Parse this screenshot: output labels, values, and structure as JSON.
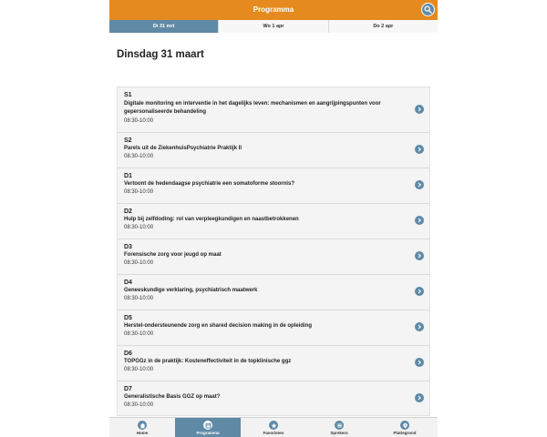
{
  "header": {
    "title": "Programma"
  },
  "tabs": [
    {
      "label": "Di 31 mrt",
      "active": true
    },
    {
      "label": "Wo 1 apr",
      "active": false
    },
    {
      "label": "Do 2 apr",
      "active": false
    }
  ],
  "day_title": "Dinsdag 31 maart",
  "sessions": [
    {
      "code": "S1",
      "title": "Digitale monitoring en interventie in het dagelijks leven: mechanismen en aangrijpingspunten voor gepersonaliseerde behandeling",
      "time": "08:30-10:00"
    },
    {
      "code": "S2",
      "title": "Parels uit de ZiekenhuisPsychiatrie Praktijk II",
      "time": "08:30-10:00"
    },
    {
      "code": "D1",
      "title": "Vertoont de hedendaagse psychiatrie een somatoforme stoornis?",
      "time": "08:30-10:00"
    },
    {
      "code": "D2",
      "title": "Hulp bij zelfdoding: rol van verpleegkundigen en naastbetrokkenen",
      "time": "08:30-10:00"
    },
    {
      "code": "D3",
      "title": "Forensische zorg voor jeugd op maat",
      "time": "08:30-10:00"
    },
    {
      "code": "D4",
      "title": "Geneeskundige verklaring, psychiatrisch maatwerk",
      "time": "08:30-10:00"
    },
    {
      "code": "D5",
      "title": "Herstel-ondersteunende zorg en shared decision making in de opleiding",
      "time": "08:30-10:00"
    },
    {
      "code": "D6",
      "title": "TOPGGz in de praktijk: Kosteneffectiviteit in de topklinische ggz",
      "time": "08:30-10:00"
    },
    {
      "code": "D7",
      "title": "Generalistische Basis GGZ op maat?",
      "time": "08:30-10:00"
    }
  ],
  "bottom_nav": [
    {
      "label": "Home",
      "icon": "home-icon",
      "active": false
    },
    {
      "label": "Programma",
      "icon": "calendar-icon",
      "active": true
    },
    {
      "label": "Favorieten",
      "icon": "star-icon",
      "active": false
    },
    {
      "label": "Sprekers",
      "icon": "list-icon",
      "active": false
    },
    {
      "label": "Plattegrond",
      "icon": "map-pin-icon",
      "active": false
    }
  ],
  "colors": {
    "accent": "#e58a1f",
    "primary": "#5f8aa6",
    "background": "#f4f4f4"
  }
}
